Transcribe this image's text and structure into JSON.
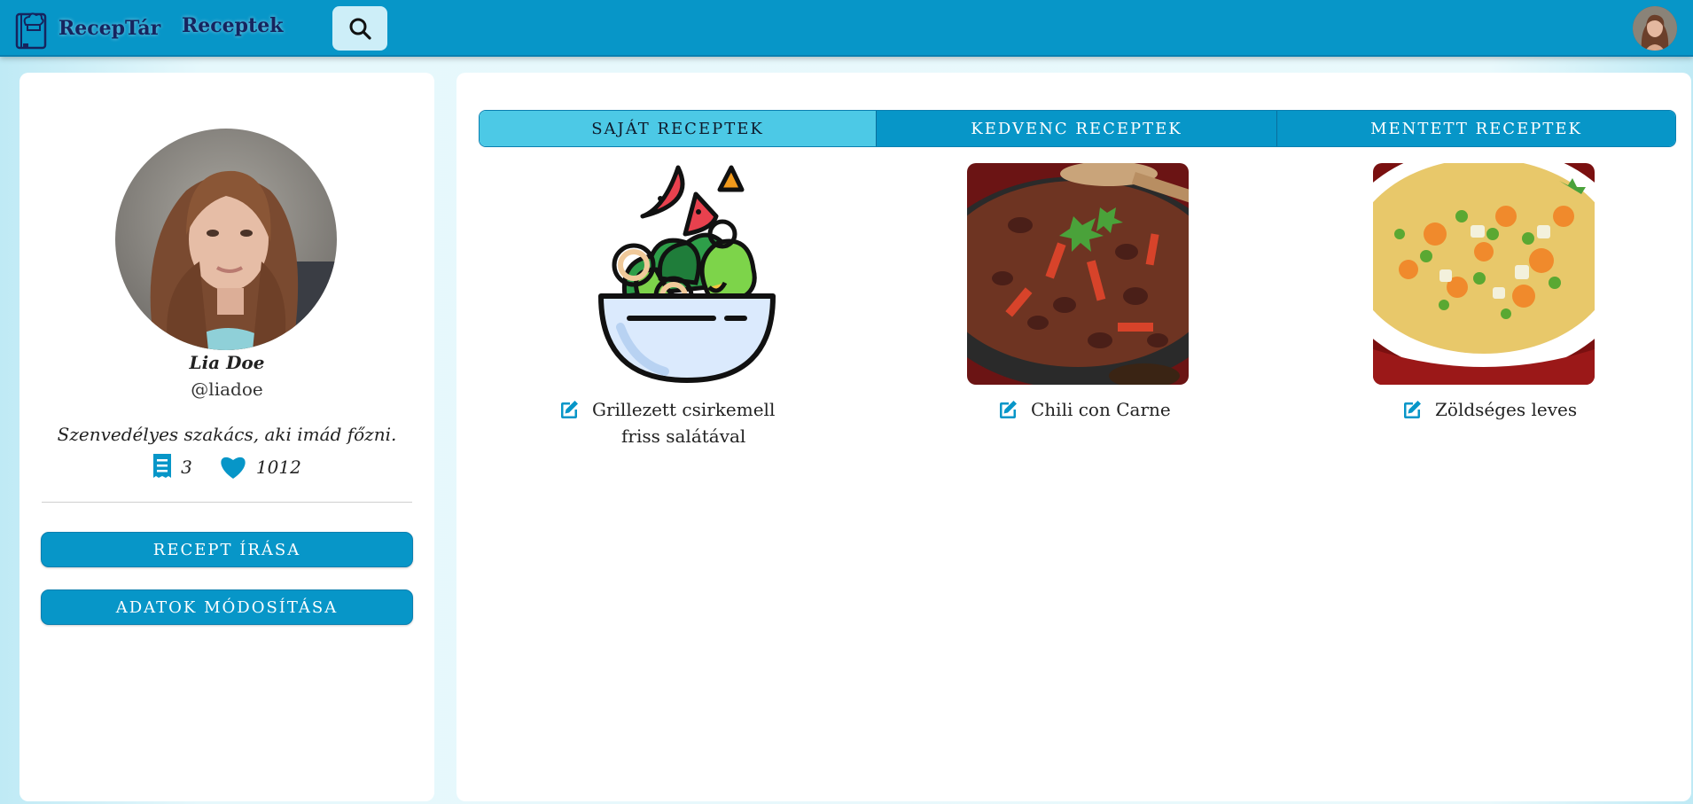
{
  "navbar": {
    "brand": "RecepTár",
    "link": "Receptek",
    "icons": {
      "logo": "chef-book-icon",
      "search": "search-icon",
      "avatar": "user-avatar"
    }
  },
  "profile": {
    "name": "Lia Doe",
    "handle": "@liadoe",
    "bio": "Szenvedélyes szakács, aki imád főzni.",
    "recipes_count": "3",
    "likes_count": "1012",
    "buttons": {
      "write_recipe": "RECEPT ÍRÁSA",
      "edit_data": "ADATOK MÓDOSÍTÁSA"
    }
  },
  "tabs": [
    {
      "label": "SAJÁT RECEPTEK",
      "active": true
    },
    {
      "label": "KEDVENC RECEPTEK",
      "active": false
    },
    {
      "label": "MENTETT RECEPTEK",
      "active": false
    }
  ],
  "recipes": [
    {
      "title_line1": "Grillezett csirkemell",
      "title_line2": "friss salátával",
      "image": "salad-bowl-icon"
    },
    {
      "title_line1": "Chili con Carne",
      "title_line2": "",
      "image": "chili-photo"
    },
    {
      "title_line1": "Zöldséges leves",
      "title_line2": "",
      "image": "vegetable-soup-photo"
    }
  ],
  "colors": {
    "primary": "#0796c8",
    "active_tab": "#4cc9e6",
    "brand_text": "#16245e",
    "background": "#e9f9fc"
  }
}
